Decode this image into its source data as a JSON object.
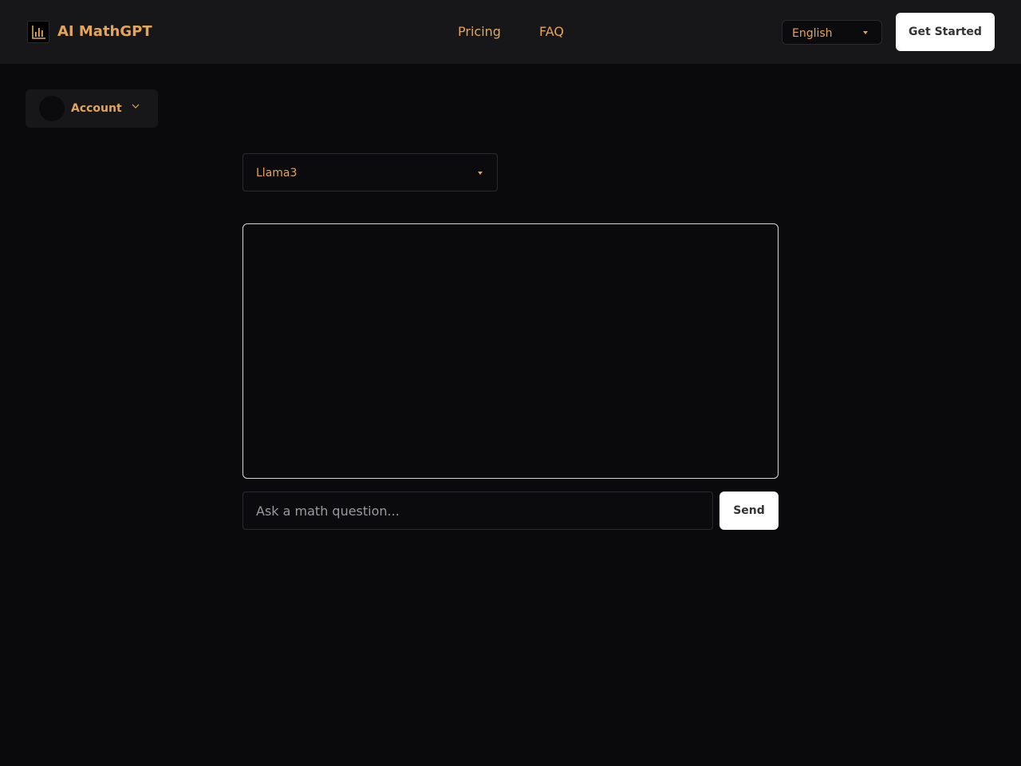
{
  "brand": {
    "name": "AI MathGPT",
    "icon": "bar-chart-icon",
    "color": "#e2a559"
  },
  "nav": {
    "links": [
      {
        "label": "Pricing"
      },
      {
        "label": "FAQ"
      }
    ],
    "language": {
      "selected": "English"
    },
    "cta": "Get Started"
  },
  "account": {
    "label": "Account"
  },
  "model": {
    "selected": "Llama3"
  },
  "chat": {
    "input_placeholder": "Ask a math question...",
    "input_value": "",
    "send_label": "Send"
  }
}
